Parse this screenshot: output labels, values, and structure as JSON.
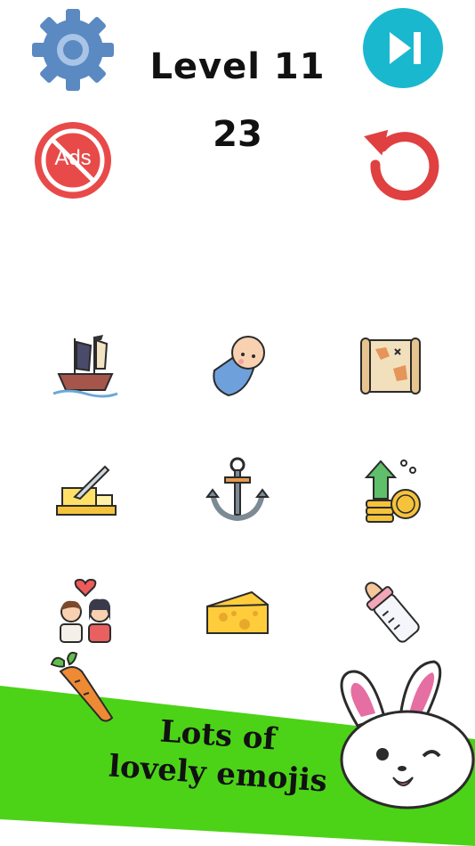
{
  "header": {
    "level_label": "Level 11",
    "score": "23"
  },
  "buttons": {
    "settings_icon": "gear-icon",
    "skip_icon": "skip-next-icon",
    "no_ads_label": "Ads",
    "restart_icon": "restart-icon"
  },
  "grid": {
    "items": [
      {
        "icon": "pirate-ship-icon"
      },
      {
        "icon": "baby-icon"
      },
      {
        "icon": "treasure-map-icon"
      },
      {
        "icon": "butter-knife-icon"
      },
      {
        "icon": "anchor-icon"
      },
      {
        "icon": "coins-growth-icon"
      },
      {
        "icon": "couple-love-icon"
      },
      {
        "icon": "cheese-icon"
      },
      {
        "icon": "baby-bottle-icon"
      }
    ]
  },
  "promo": {
    "line1": "Lots of",
    "line2": "lovely emojis",
    "colors": {
      "banner": "#4cd318",
      "skip": "#1ab8cf",
      "settings": "#5b89c2",
      "ads": "#e84a4a",
      "restart": "#e04040"
    }
  }
}
